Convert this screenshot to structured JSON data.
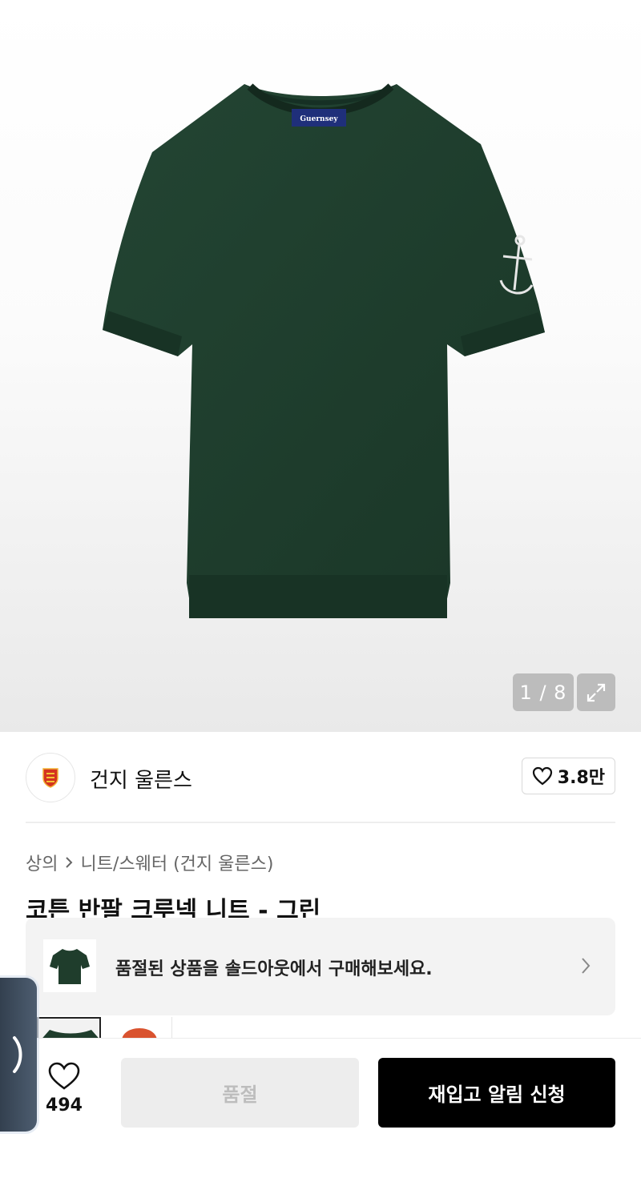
{
  "gallery": {
    "current_index": 1,
    "total": 8,
    "counter_text": "1 / 8",
    "label_text": "Guernsey"
  },
  "brand": {
    "name": "건지 울른스",
    "like_count": "3.8만"
  },
  "breadcrumb": {
    "items": [
      "상의",
      "니트/스웨터 (건지 울른스)"
    ]
  },
  "product": {
    "title": "코튼 반팔 크루넥 니트 - 그린",
    "color": "#1f3d2c"
  },
  "soldout_banner": {
    "text": "품절된 상품을 솔드아웃에서 구매해보세요."
  },
  "bottom_bar": {
    "like_count": "494",
    "soldout_label": "품절",
    "restock_label": "재입고 알림 신청"
  },
  "icons": {
    "expand": "expand-icon",
    "heart": "heart-icon",
    "chevron": "chevron-right-icon"
  }
}
